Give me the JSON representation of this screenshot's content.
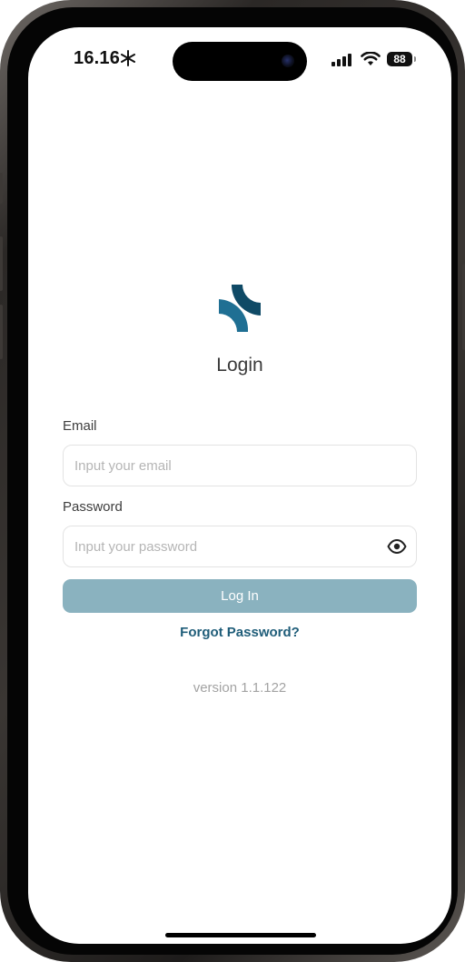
{
  "status_bar": {
    "time": "16.16",
    "extra_icon": "snowflake-icon",
    "battery_level": "88",
    "icons": [
      "signal-icon",
      "wifi-icon",
      "battery-icon"
    ]
  },
  "app": {
    "logo": "app-logo",
    "title": "Login"
  },
  "form": {
    "email": {
      "label": "Email",
      "placeholder": "Input your email",
      "value": ""
    },
    "password": {
      "label": "Password",
      "placeholder": "Input your password",
      "value": "",
      "toggle_icon": "eye-icon"
    },
    "submit_label": "Log In",
    "forgot_label": "Forgot Password?"
  },
  "footer": {
    "version": "version 1.1.122"
  },
  "colors": {
    "brand_dark": "#0f4a66",
    "brand_light": "#1f6f93",
    "button": "#8ab2bf",
    "link": "#1f5d79"
  }
}
